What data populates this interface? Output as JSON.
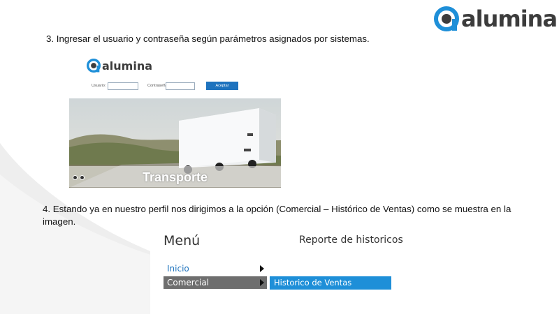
{
  "brand": {
    "name": "alumina"
  },
  "steps": {
    "step3": "3. Ingresar el usuario y contraseña según parámetros asignados por sistemas.",
    "step4": "4. Estando ya en nuestro perfil nos dirigimos a la opción (Comercial – Histórico de Ventas) como se muestra en la imagen."
  },
  "login_screen": {
    "logo_text": "alumina",
    "usuario_label": "Usuario:",
    "password_label": "Contraseña:",
    "usuario_value": "",
    "password_value": "",
    "accept_label": "Aceptar",
    "banner_title": "Transporte"
  },
  "menu_screen": {
    "menu_title": "Menú",
    "report_title": "Reporte de historicos",
    "items": [
      {
        "label": "Inicio"
      },
      {
        "label": "Comercial"
      }
    ],
    "submenu_item": "Historico de Ventas"
  },
  "colors": {
    "brand_blue": "#1e8fd8",
    "accent_dark": "#3c3c3c",
    "selected_gray": "#6e6e6e"
  }
}
